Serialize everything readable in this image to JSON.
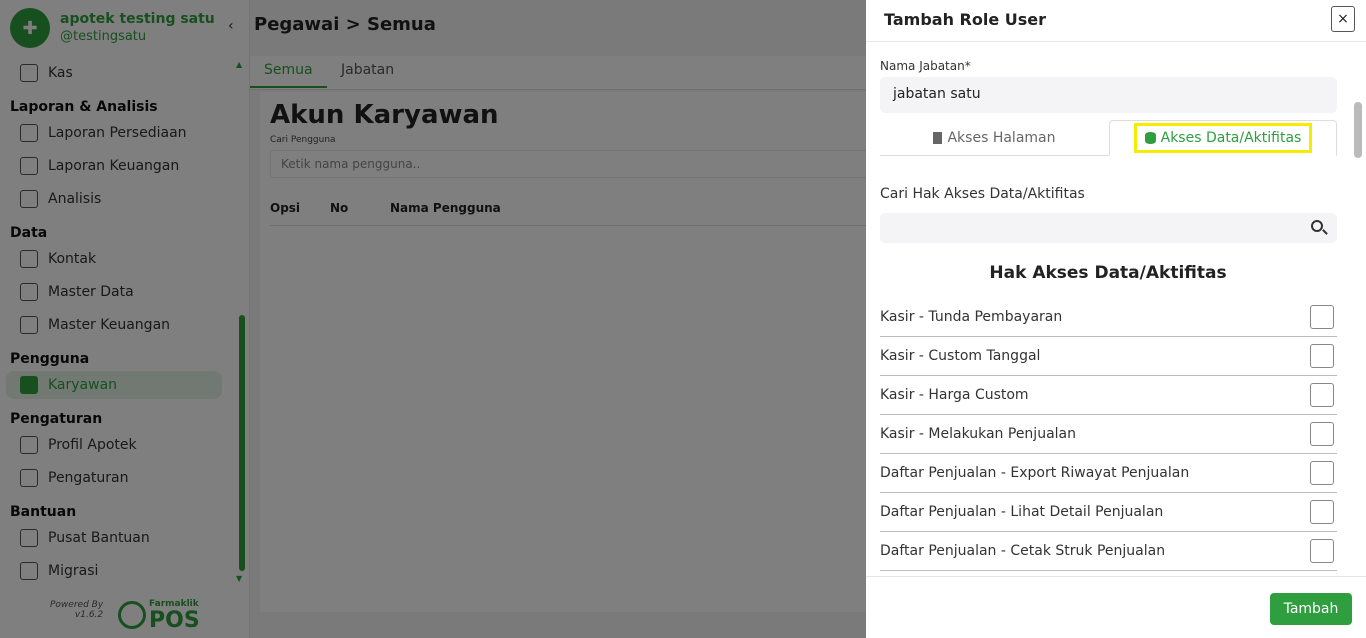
{
  "sidebar": {
    "brand_name": "apotek testing satu",
    "brand_handle": "@testingsatu",
    "collapse_glyph": "‹",
    "items": [
      {
        "label": "Kas"
      },
      {
        "section": "Laporan & Analisis"
      },
      {
        "label": "Laporan Persediaan"
      },
      {
        "label": "Laporan Keuangan"
      },
      {
        "label": "Analisis"
      },
      {
        "section": "Data"
      },
      {
        "label": "Kontak"
      },
      {
        "label": "Master Data"
      },
      {
        "label": "Master Keuangan"
      },
      {
        "section": "Pengguna"
      },
      {
        "label": "Karyawan",
        "active": true
      },
      {
        "section": "Pengaturan"
      },
      {
        "label": "Profil Apotek"
      },
      {
        "label": "Pengaturan"
      },
      {
        "section": "Bantuan"
      },
      {
        "label": "Pusat Bantuan"
      },
      {
        "label": "Migrasi"
      }
    ],
    "powered_by": "Powered By",
    "version": "v1.6.2",
    "farmaklik_small": "Farmaklik",
    "farmaklik_big": "POS"
  },
  "main": {
    "page_title": "Pegawai > Semua",
    "tabs": [
      "Semua",
      "Jabatan"
    ],
    "content_title": "Akun Karyawan",
    "search_label": "Cari Pengguna",
    "search_placeholder": "Ketik nama pengguna..",
    "table_headers": [
      "Opsi",
      "No",
      "Nama Pengguna"
    ]
  },
  "modal": {
    "title": "Tambah Role User",
    "close_label": "×",
    "name_label": "Nama Jabatan*",
    "name_value": "jabatan satu",
    "tabs": [
      "Akses Halaman",
      "Akses Data/Aktifitas"
    ],
    "active_tab": 1,
    "search_label": "Cari Hak Akses Data/Aktifitas",
    "list_title": "Hak Akses Data/Aktifitas",
    "permissions": [
      "Kasir - Tunda Pembayaran",
      "Kasir - Custom Tanggal",
      "Kasir - Harga Custom",
      "Kasir - Melakukan Penjualan",
      "Daftar Penjualan - Export Riwayat Penjualan",
      "Daftar Penjualan - Lihat Detail Penjualan",
      "Daftar Penjualan - Cetak Struk Penjualan"
    ],
    "submit_label": "Tambah"
  },
  "colors": {
    "accent": "#2e9e3f",
    "highlight": "#f5ec00"
  }
}
